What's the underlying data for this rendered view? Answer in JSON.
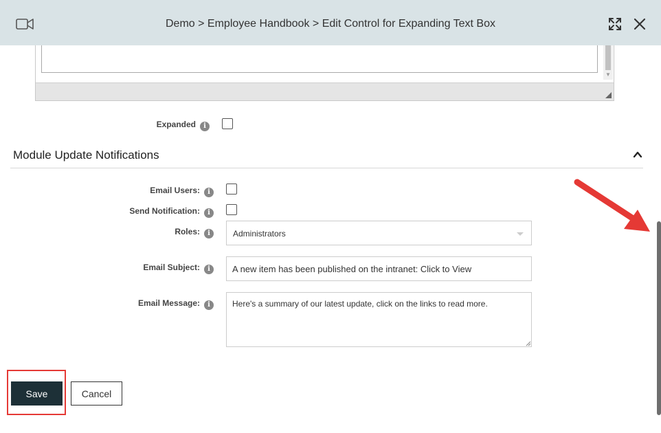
{
  "header": {
    "title": "Demo > Employee Handbook > Edit Control for Expanding Text Box",
    "icons": {
      "left": "video-camera-icon",
      "expand": "expand-arrows-icon",
      "close": "close-icon"
    }
  },
  "fields": {
    "expanded": {
      "label": "Expanded",
      "checked": false
    }
  },
  "section": {
    "title": "Module Update Notifications",
    "collapse_icon": "chevron-up-icon"
  },
  "notifications": {
    "email_users": {
      "label": "Email Users:",
      "checked": false
    },
    "send_notification": {
      "label": "Send Notification:",
      "checked": false
    },
    "roles": {
      "label": "Roles:",
      "value": "Administrators"
    },
    "email_subject": {
      "label": "Email Subject:",
      "value": "A new item has been published on the intranet: Click to View"
    },
    "email_message": {
      "label": "Email Message:",
      "value": "Here's a summary of our latest update, click on the links to read more."
    }
  },
  "info_glyph": "i",
  "buttons": {
    "save": "Save",
    "cancel": "Cancel"
  },
  "colors": {
    "header_bg": "#d9e3e6",
    "save_bg": "#1d3037",
    "annotation": "#e53935"
  }
}
